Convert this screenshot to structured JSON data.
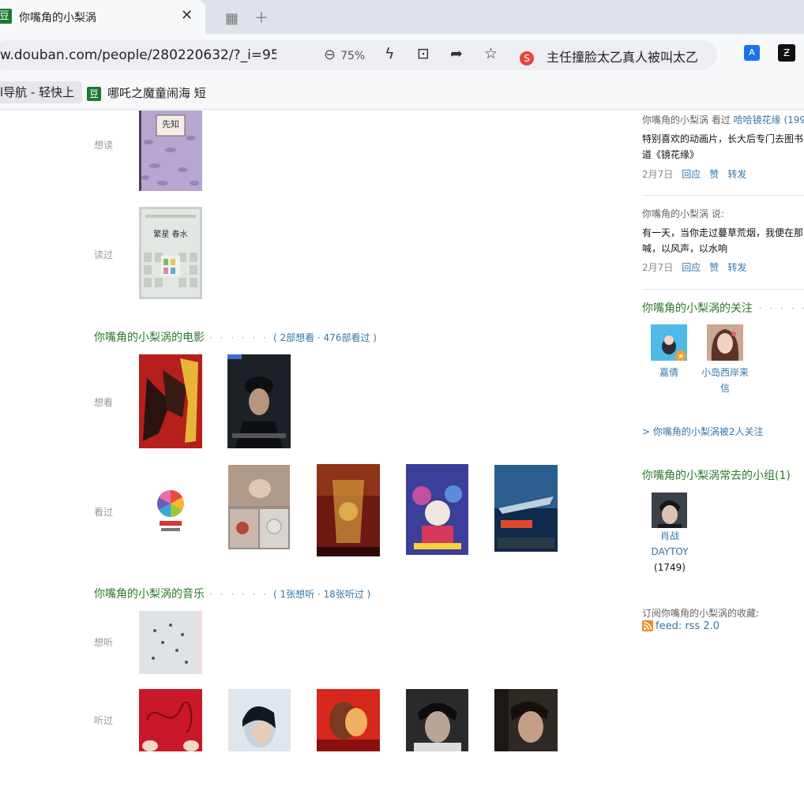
{
  "browser": {
    "tab_title": "你嘴角的小梨涡",
    "tab_favicon": "豆",
    "url": "w.douban.com/people/280220632/?_i=9501",
    "zoom": "75%",
    "search_text": "主任撞脸太乙真人被叫太乙",
    "bookmark_1": "l导航 - 轻快上",
    "bookmark_2": "哪吒之魔童闹海 短"
  },
  "books": {
    "want_label": "想读",
    "read_label": "读过",
    "book1_title": "先知",
    "book2_title": "繁星 春水"
  },
  "movies": {
    "title": "你嘴角的小梨涡的电影",
    "dots": "· · · · · ·",
    "count": "( 2部想看 · 476部看过 )",
    "want_label": "想看",
    "watched_label": "看过"
  },
  "music": {
    "title": "你嘴角的小梨涡的音乐",
    "dots": "· · · · · ·",
    "count": "( 1张想听 · 18张听过 )",
    "want_label": "想听",
    "heard_label": "听过"
  },
  "feed1": {
    "head_prefix": "你嘴角的小梨涡 看过 ",
    "head_link": "哈哈镜花缘 (199",
    "line1": "特别喜欢的动画片，长大后专门去图书",
    "line2": "道《镜花缘》",
    "date": "2月7日",
    "reply": "回应",
    "like": "赞",
    "share": "转发"
  },
  "feed2": {
    "head": "你嘴角的小梨涡 说:",
    "line1": "有一天，当你走过蔓草荒烟，我便在那",
    "line2": "喊，以风声，以水响",
    "date": "2月7日",
    "reply": "回应",
    "like": "赞",
    "share": "转发"
  },
  "following": {
    "title": "你嘴角的小梨涡的关注",
    "dots": "· · · · ·",
    "user1": "嘉倩",
    "user2_line1": "小岛西岸来",
    "user2_line2": "信",
    "followers": "> 你嘴角的小梨涡被2人关注"
  },
  "groups": {
    "title": "你嘴角的小梨涡常去的小组(1)",
    "group_line1": "肖战",
    "group_line2": "DAYTOY",
    "group_count": "(1749)"
  },
  "subscribe": {
    "label": "订阅你嘴角的小梨涡的收藏:",
    "feed": "feed: rss 2.0"
  }
}
